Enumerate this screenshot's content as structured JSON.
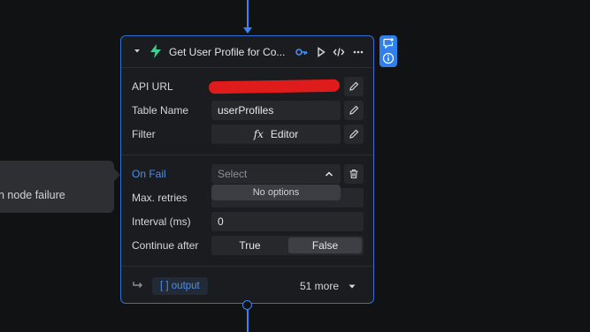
{
  "node": {
    "title": "Get User Profile for Co...",
    "icons": {
      "collapse": "chevron-down-icon",
      "type": "bolt-icon",
      "key": "key-icon",
      "run": "play-icon",
      "code": "code-icon",
      "menu": "more-horizontal-icon"
    },
    "fields": [
      {
        "label": "API URL",
        "value": "",
        "redacted": true
      },
      {
        "label": "Table Name",
        "value": "userProfiles"
      },
      {
        "label": "Filter",
        "value": "Editor",
        "prefix": "fx"
      }
    ],
    "on_fail": {
      "label": "On Fail",
      "placeholder": "Select",
      "dropdown_text": "No options"
    },
    "max_retries": {
      "label": "Max. retries",
      "value": ""
    },
    "interval": {
      "label": "Interval (ms)",
      "value": "0"
    },
    "continue_after": {
      "label": "Continue after",
      "options": [
        "True",
        "False"
      ],
      "selected": "False"
    },
    "footer": {
      "output_label": "[ ]  output",
      "more_label": "51 more"
    }
  },
  "tooltip": {
    "text": "n node failure"
  },
  "colors": {
    "accent": "#3b82f6",
    "bolt": "#3ecf8e",
    "on_fail": "#4a8ef5",
    "redaction": "#e01b1b"
  }
}
